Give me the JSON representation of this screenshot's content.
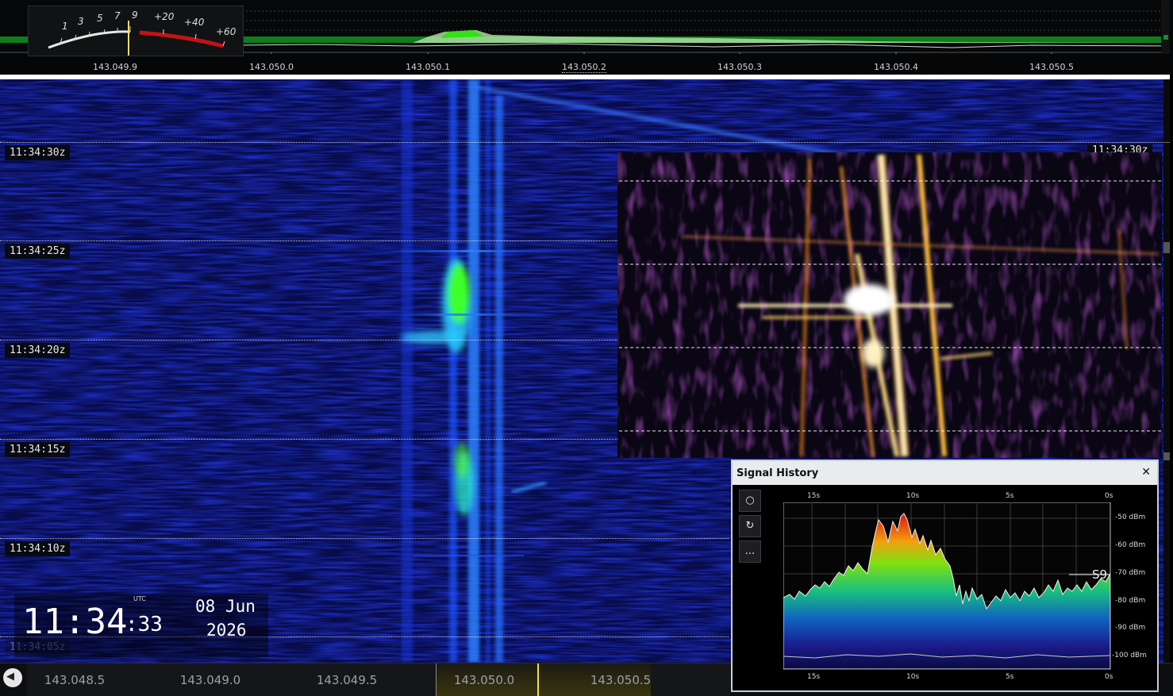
{
  "smeter": {
    "scale_labels": [
      "1",
      "3",
      "5",
      "7",
      "9",
      "+20",
      "+40",
      "+60"
    ]
  },
  "top_freq_labels": [
    "143.049.9",
    "143.050.0",
    "143.050.1",
    "143.050.2",
    "143.050.3",
    "143.050.4",
    "143.050.5"
  ],
  "waterfall": {
    "time_tags": [
      "11:34:30z",
      "11:34:25z",
      "11:34:20z",
      "11:34:15z",
      "11:34:10z",
      "11:34:05z"
    ],
    "right_time_tag": "11:34:30z"
  },
  "clock": {
    "hhmm": "11:34",
    "seconds": ":33",
    "utc_label": "UTC",
    "date_line1": "08 Jun",
    "date_line2": "2026"
  },
  "bottom_freq_labels": [
    "143.048.5",
    "143.049.0",
    "143.049.5",
    "143.050.0",
    "143.050.5"
  ],
  "signal_history": {
    "title": "Signal History",
    "close_symbol": "✕",
    "buttons": [
      "○",
      "↻",
      "..."
    ],
    "time_ticks": [
      "15s",
      "10s",
      "5s",
      "0s"
    ],
    "dbm_ticks": [
      "-50 dBm",
      "-60 dBm",
      "-70 dBm",
      "-80 dBm",
      "-90 dBm",
      "-100 dBm"
    ],
    "s_marker": "S9"
  },
  "colors": {
    "waterfall_bg": "#0a0f5a",
    "signal_blue": "#2a6cff",
    "signal_green": "#3cff2a",
    "zoom_hot": "#ffd060",
    "meter_red": "#d01010"
  }
}
